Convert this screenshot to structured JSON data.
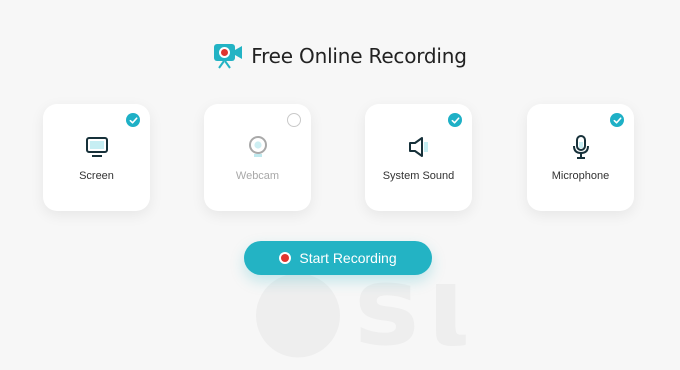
{
  "header": {
    "title": "Free Online Recording"
  },
  "options": [
    {
      "label": "Screen",
      "checked": true,
      "icon": "monitor-icon"
    },
    {
      "label": "Webcam",
      "checked": false,
      "icon": "webcam-icon"
    },
    {
      "label": "System Sound",
      "checked": true,
      "icon": "speaker-icon"
    },
    {
      "label": "Microphone",
      "checked": true,
      "icon": "microphone-icon"
    }
  ],
  "actions": {
    "start_label": "Start Recording"
  },
  "colors": {
    "accent": "#1eb0c6",
    "record": "#e0352f",
    "icon_dark": "#17313a",
    "background": "#f7f7f7"
  }
}
